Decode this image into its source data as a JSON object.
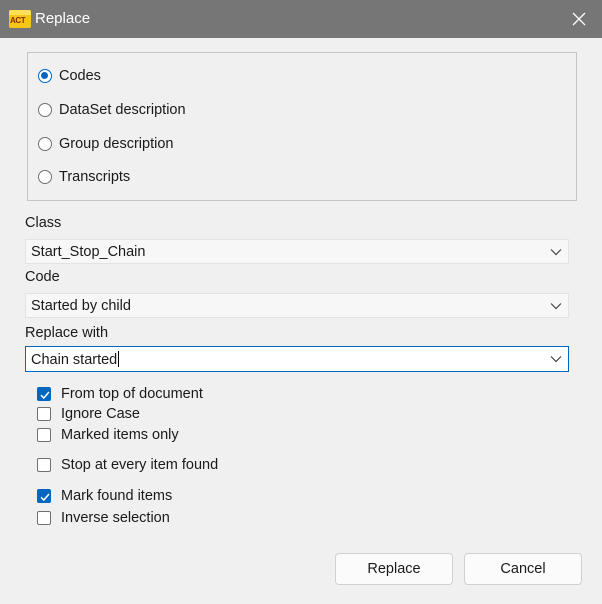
{
  "window": {
    "title": "Replace",
    "app_icon_text": "Inter\nACT"
  },
  "search_in": {
    "options": [
      {
        "label": "Codes",
        "selected": true
      },
      {
        "label": "DataSet description",
        "selected": false
      },
      {
        "label": "Group description",
        "selected": false
      },
      {
        "label": "Transcripts",
        "selected": false
      }
    ]
  },
  "fields": {
    "class": {
      "label": "Class",
      "value": "Start_Stop_Chain"
    },
    "code": {
      "label": "Code",
      "value": "Started by child"
    },
    "replace_with": {
      "label": "Replace with",
      "value": "Chain started"
    }
  },
  "options": [
    {
      "label": "From top of document",
      "checked": true
    },
    {
      "label": "Ignore Case",
      "checked": false
    },
    {
      "label": "Marked items only",
      "checked": false
    },
    {
      "label": "Stop at every item found",
      "checked": false
    },
    {
      "label": "Mark found items",
      "checked": true
    },
    {
      "label": "Inverse selection",
      "checked": false
    }
  ],
  "buttons": {
    "replace": "Replace",
    "cancel": "Cancel"
  },
  "colors": {
    "accent": "#0067c0",
    "titlebar": "#767676",
    "background": "#f0f0f0"
  },
  "icons": {
    "close": "close-icon",
    "dropdown": "chevron-down-icon",
    "check": "checkmark-icon"
  }
}
